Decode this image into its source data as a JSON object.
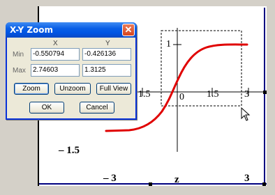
{
  "dialog": {
    "title": "X-Y Zoom",
    "close_glyph": "✕",
    "col_x": "X",
    "col_y": "Y",
    "row_min": "Min",
    "row_max": "Max",
    "x_min": "-0.550794",
    "y_min": "-0.426136",
    "x_max": "2.74603",
    "y_max": "1.3125",
    "buttons": {
      "zoom": "Zoom",
      "unzoom": "Unzoom",
      "full_view": "Full View",
      "ok": "OK",
      "cancel": "Cancel"
    }
  },
  "plot": {
    "tick_labels": {
      "y_one": "1",
      "x_neg_one_five": "1.5",
      "x_zero": "0",
      "x_one_five": "1.5",
      "x_three": "3",
      "y_neg_one_five": "– 1.5",
      "bottom_neg_three": "– 3",
      "bottom_z": "z",
      "bottom_three": "3"
    },
    "curve_color": "#e00000",
    "frame_color": "#000080"
  }
}
